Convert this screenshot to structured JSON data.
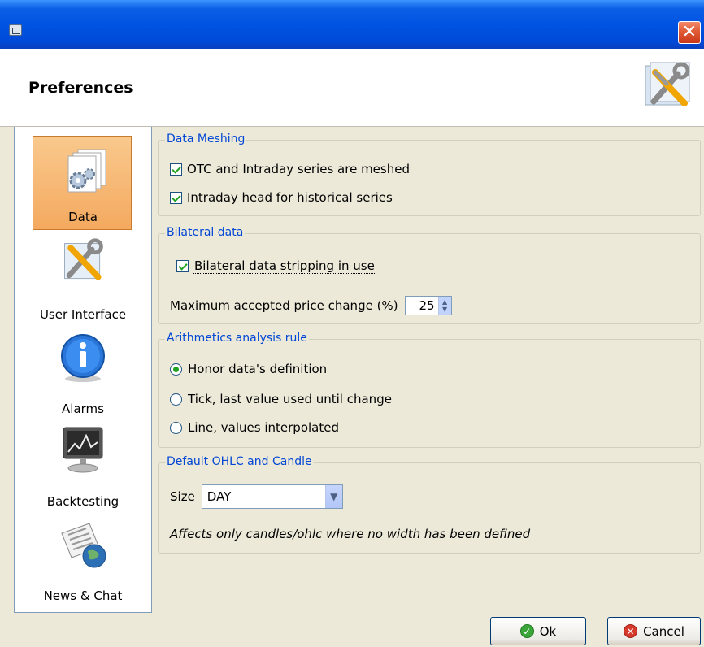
{
  "window": {
    "app_icon": "window-app-icon",
    "close_icon": "close-icon",
    "close_glyph": "✕"
  },
  "header": {
    "title": "Preferences",
    "icon": "tools-icon"
  },
  "sidebar": {
    "items": [
      {
        "label": "Data",
        "icon": "data-settings-icon",
        "selected": true
      },
      {
        "label": "User Interface",
        "icon": "tools-icon",
        "selected": false
      },
      {
        "label": "Alarms",
        "icon": "info-icon",
        "selected": false
      },
      {
        "label": "Backtesting",
        "icon": "monitor-chart-icon",
        "selected": false
      },
      {
        "label": "News & Chat",
        "icon": "newspaper-globe-icon",
        "selected": false
      }
    ]
  },
  "groups": {
    "meshing": {
      "title": "Data Meshing",
      "otc_label": "OTC and Intraday series are meshed",
      "otc_checked": true,
      "intraday_label": "Intraday head for historical series",
      "intraday_checked": true
    },
    "bilateral": {
      "title": "Bilateral data",
      "strip_label": "Bilateral data stripping in use",
      "strip_checked": true,
      "max_change_label": "Maximum accepted price change (%)",
      "max_change_value": "25"
    },
    "arithmetics": {
      "title": "Arithmetics analysis rule",
      "options": [
        {
          "label": "Honor data's definition",
          "checked": true
        },
        {
          "label": "Tick, last value used until change",
          "checked": false
        },
        {
          "label": "Line, values interpolated",
          "checked": false
        }
      ]
    },
    "ohlc": {
      "title": "Default OHLC and Candle",
      "size_label": "Size",
      "size_value": "DAY",
      "note": "Affects only candles/ohlc where no width has been defined"
    }
  },
  "footer": {
    "ok_label": "Ok",
    "cancel_label": "Cancel",
    "ok_icon": "check-icon",
    "cancel_icon": "cancel-icon"
  },
  "colors": {
    "accent": "#0046d5",
    "selection": "#f4a95f",
    "title_bar": "#0053e1"
  }
}
